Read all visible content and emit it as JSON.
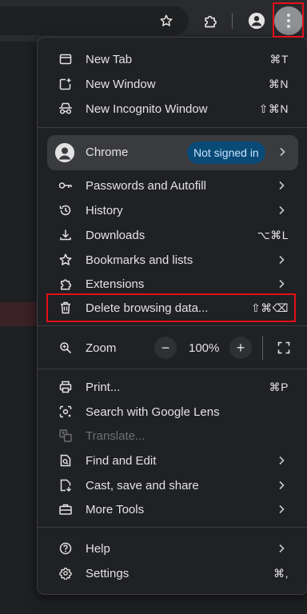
{
  "menu": {
    "top_items": [
      {
        "label": "New Tab",
        "shortcut": "⌘T",
        "icon": "new-tab-icon"
      },
      {
        "label": "New Window",
        "shortcut": "⌘N",
        "icon": "new-window-icon"
      },
      {
        "label": "New Incognito Window",
        "shortcut": "⇧⌘N",
        "icon": "incognito-icon"
      }
    ],
    "profile": {
      "name": "Chrome",
      "status": "Not signed in",
      "icon": "person-icon"
    },
    "main_items": [
      {
        "label": "Passwords and Autofill",
        "icon": "key-icon"
      },
      {
        "label": "History",
        "icon": "history-icon"
      },
      {
        "label": "Downloads",
        "shortcut": "⌥⌘L",
        "icon": "download-icon"
      },
      {
        "label": "Bookmarks and lists",
        "icon": "star-icon"
      },
      {
        "label": "Extensions",
        "icon": "puzzle-icon"
      },
      {
        "label": "Delete browsing data...",
        "shortcut": "⇧⌘⌫",
        "icon": "trash-icon"
      }
    ],
    "zoom": {
      "label": "Zoom",
      "value": "100%",
      "minus": "−",
      "plus": "+",
      "icon": "zoom-icon"
    },
    "tool_items": [
      {
        "label": "Print...",
        "shortcut": "⌘P",
        "icon": "print-icon"
      },
      {
        "label": "Search with Google Lens",
        "icon": "lens-icon"
      },
      {
        "label": "Translate...",
        "icon": "translate-icon",
        "disabled": true
      },
      {
        "label": "Find and Edit",
        "icon": "find-icon"
      },
      {
        "label": "Cast, save and share",
        "icon": "cast-save-icon"
      },
      {
        "label": "More Tools",
        "icon": "toolbox-icon"
      }
    ],
    "bottom_items": [
      {
        "label": "Help",
        "icon": "help-icon"
      },
      {
        "label": "Settings",
        "shortcut": "⌘,",
        "icon": "settings-icon"
      }
    ]
  },
  "colors": {
    "menu_bg": "#202124",
    "badge_bg": "#0a4a76",
    "highlight_border": "#e3101a"
  }
}
